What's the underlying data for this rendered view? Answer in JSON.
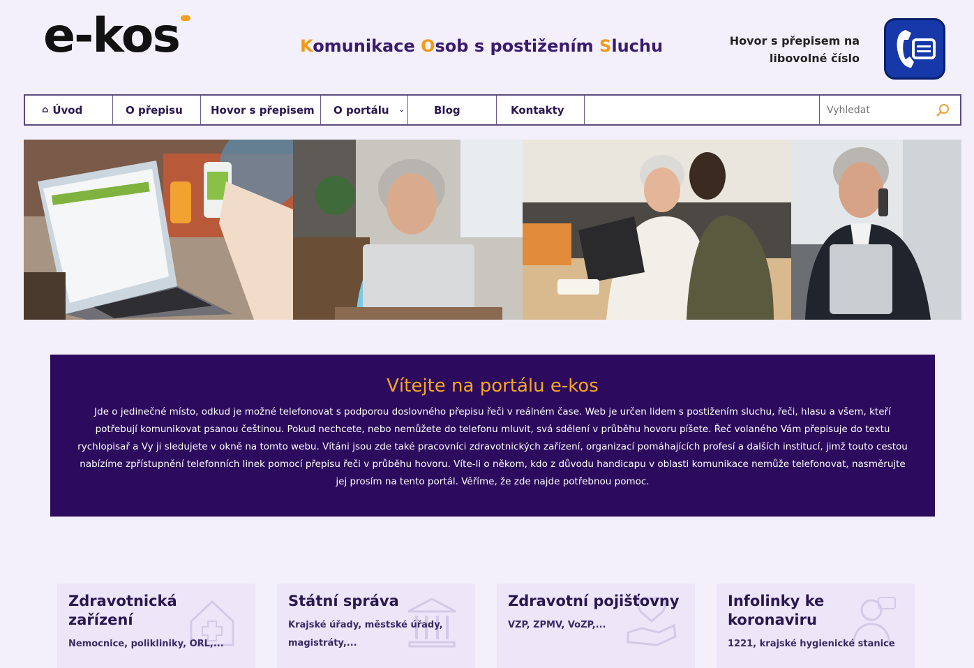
{
  "header": {
    "logo_text": "e-kos",
    "tagline_parts": [
      {
        "t": "K",
        "accent": true
      },
      {
        "t": "omunikace ",
        "accent": false
      },
      {
        "t": "O",
        "accent": true
      },
      {
        "t": "sob s postižením ",
        "accent": false
      },
      {
        "t": "S",
        "accent": true
      },
      {
        "t": "luchu",
        "accent": false
      }
    ],
    "call_line1": "Hovor s přepisem na",
    "call_line2": "libovolné číslo",
    "call_icon": "phone-subtitle-icon"
  },
  "nav": {
    "items": [
      {
        "label": "Úvod",
        "icon": "home-icon"
      },
      {
        "label": "O přepisu"
      },
      {
        "label": "Hovor s přepisem"
      },
      {
        "label": "O portálu",
        "dropdown": true
      },
      {
        "label": "Blog"
      },
      {
        "label": "Kontakty"
      }
    ],
    "search_placeholder": "Vyhledat"
  },
  "hero": {
    "photos": [
      "laptop-and-phone-photo",
      "senior-woman-phone-laptop-photo",
      "grandmother-granddaughter-tablet-photo",
      "man-phone-tablet-photo"
    ]
  },
  "welcome": {
    "title": "Vítejte na portálu e-kos",
    "text": "Jde o jedinečné místo, odkud je možné telefonovat s podporou doslovného přepisu řeči v reálném čase. Web je určen lidem s postižením sluchu, řeči, hlasu a všem, kteří potřebují komunikovat psanou češtinou. Pokud nechcete, nebo nemůžete do telefonu mluvit, svá sdělení v průběhu hovoru píšete. Řeč volaného Vám přepisuje do textu rychlopisař a Vy ji sledujete v okně na tomto webu. Vítáni jsou zde také pracovníci zdravotnických zařízení, organizací pomáhajících profesí a dalších institucí, jimž touto cestou nabízíme zpřístupnění telefonních linek pomocí přepisu řeči v průběhu hovoru. Víte-li o někom, kdo z důvodu handicapu v oblasti komunikace nemůže telefonovat, nasměrujte jej prosím na tento portál. Věříme, že zde najde potřebnou pomoc."
  },
  "cards": [
    {
      "title": "Zdravotnická zařízení",
      "desc": "Nemocnice, polikliniky, ORL,...",
      "icon": "hospital-icon"
    },
    {
      "title": "Státní správa",
      "desc": "Krajské úřady, městské úřady, magistráty,...",
      "icon": "government-building-icon"
    },
    {
      "title": "Zdravotní pojišťovny",
      "desc": "VZP, ZPMV, VoZP,...",
      "icon": "insurance-hand-icon"
    },
    {
      "title": "Infolinky ke koronaviru",
      "desc": "1221, krajské hygienické stanice",
      "icon": "hotline-operator-icon"
    }
  ],
  "colors": {
    "accent": "#f39a14",
    "brand_dark": "#2c0a5e",
    "text": "#2a1650"
  }
}
